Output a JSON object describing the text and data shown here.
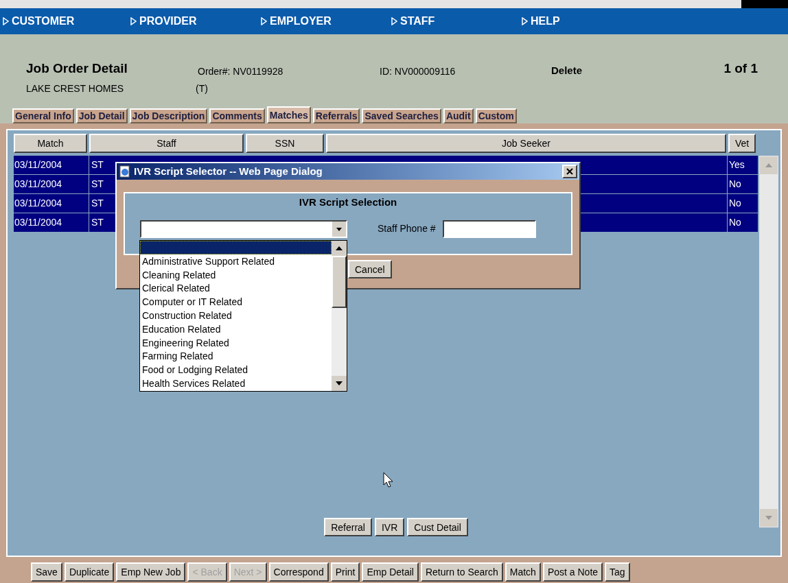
{
  "nav": [
    {
      "label": "CUSTOMER"
    },
    {
      "label": "PROVIDER"
    },
    {
      "label": "EMPLOYER"
    },
    {
      "label": "STAFF"
    },
    {
      "label": "HELP"
    }
  ],
  "header": {
    "title": "Job Order Detail",
    "order": "Order#:  NV0119928",
    "id": "ID:  NV000009116",
    "delete": "Delete",
    "pager": "1 of 1",
    "company": "LAKE CREST HOMES",
    "type": "(T)"
  },
  "tabs": [
    {
      "label": "General Info",
      "selected": false
    },
    {
      "label": "Job Detail",
      "selected": false
    },
    {
      "label": "Job Description",
      "selected": false
    },
    {
      "label": "Comments",
      "selected": false
    },
    {
      "label": "Matches",
      "selected": true
    },
    {
      "label": "Referrals",
      "selected": false
    },
    {
      "label": "Saved Searches",
      "selected": false
    },
    {
      "label": "Audit",
      "selected": false
    },
    {
      "label": "Custom",
      "selected": false
    }
  ],
  "table": {
    "columns": [
      "Match",
      "Staff",
      "SSN",
      "Job Seeker",
      "Vet"
    ],
    "rows": [
      {
        "match": "03/11/2004",
        "staff": "ST",
        "vet": "Yes",
        "selected": true
      },
      {
        "match": "03/11/2004",
        "staff": "ST",
        "vet": "No",
        "selected": true
      },
      {
        "match": "03/11/2004",
        "staff": "ST",
        "vet": "No",
        "selected": true
      },
      {
        "match": "03/11/2004",
        "staff": "ST",
        "vet": "No",
        "selected": true
      }
    ]
  },
  "actions": [
    "Referral",
    "IVR",
    "Cust Detail"
  ],
  "dialog": {
    "title": "IVR Script Selector -- Web Page Dialog",
    "heading": "IVR Script Selection",
    "phone_label": "Staff Phone #",
    "cancel": "Cancel",
    "options": [
      {
        "selected": true
      },
      {
        "label": "Administrative Support Related",
        "selected": false
      },
      {
        "label": "Cleaning Related",
        "selected": false
      },
      {
        "label": "Clerical Related",
        "selected": false
      },
      {
        "label": "Computer or IT Related",
        "selected": false
      },
      {
        "label": "Construction Related",
        "selected": false
      },
      {
        "label": "Education Related",
        "selected": false
      },
      {
        "label": "Engineering Related",
        "selected": false
      },
      {
        "label": "Farming Related",
        "selected": false
      },
      {
        "label": "Food or Lodging Related",
        "selected": false
      },
      {
        "label": "Health Services Related",
        "selected": false
      }
    ]
  },
  "footer": [
    {
      "label": "Save",
      "disabled": false
    },
    {
      "label": "Duplicate",
      "disabled": false
    },
    {
      "label": "Emp New Job",
      "disabled": false
    },
    {
      "label": "< Back",
      "disabled": true
    },
    {
      "label": "Next >",
      "disabled": true
    },
    {
      "label": "Correspond",
      "disabled": false
    },
    {
      "label": "Print",
      "disabled": false
    },
    {
      "label": "Emp Detail",
      "disabled": false
    },
    {
      "label": "Return to Search",
      "disabled": false
    },
    {
      "label": "Match",
      "disabled": false
    },
    {
      "label": "Post a Note",
      "disabled": false
    },
    {
      "label": "Tag",
      "disabled": false
    }
  ]
}
